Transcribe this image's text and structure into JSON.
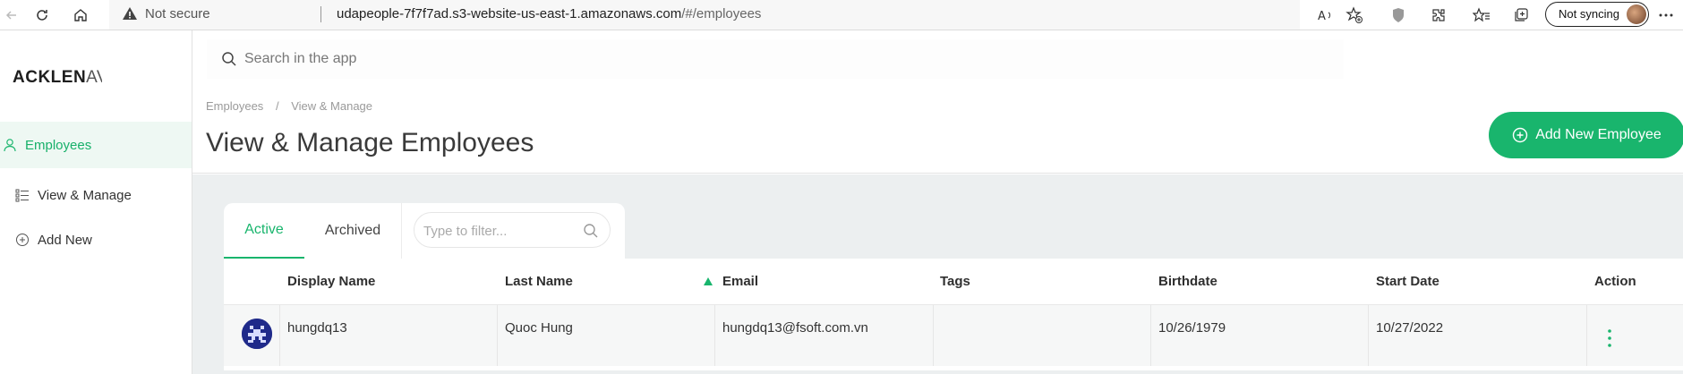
{
  "browser": {
    "not_secure": "Not secure",
    "url_host": "udapeople-7f7f7ad.s3-website-us-east-1.amazonaws.com",
    "url_path": "/#/employees",
    "sync_label": "Not syncing"
  },
  "app": {
    "logo": "ACKLEN",
    "logo_tail": "AV"
  },
  "search": {
    "placeholder": "Search in the app"
  },
  "sidebar": {
    "items": [
      {
        "label": "Employees"
      },
      {
        "label": "View & Manage"
      },
      {
        "label": "Add New"
      }
    ]
  },
  "breadcrumb": {
    "items": [
      "Employees",
      "/",
      "View & Manage"
    ]
  },
  "page": {
    "title": "View & Manage Employees",
    "add_button": "Add New Employee"
  },
  "tabs": {
    "active": "Active",
    "archived": "Archived",
    "filter_placeholder": "Type to filter..."
  },
  "table": {
    "headers": [
      "Display Name",
      "Last Name",
      "Email",
      "Tags",
      "Birthdate",
      "Start Date",
      "Action"
    ],
    "rows": [
      {
        "display_name": "hungdq13",
        "last_name": "Quoc Hung",
        "email": "hungdq13@fsoft.com.vn",
        "tags": "",
        "birthdate": "10/26/1979",
        "start_date": "10/27/2022"
      }
    ]
  },
  "colors": {
    "accent": "#19b56d",
    "sidebar_active_bg": "#eef8f3",
    "content_bg": "#eceff0"
  }
}
